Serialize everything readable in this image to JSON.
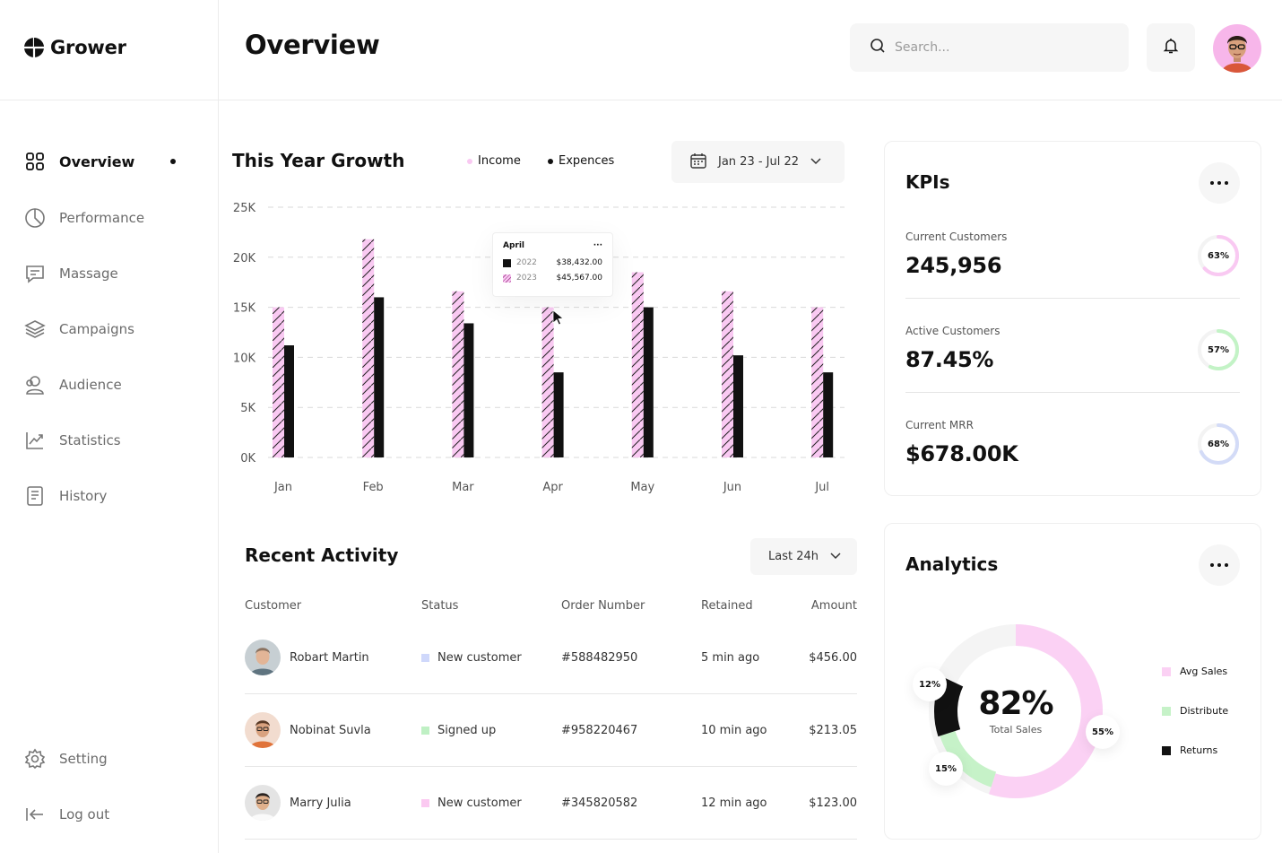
{
  "app": {
    "name": "Grower"
  },
  "sidebar": {
    "items": [
      {
        "label": "Overview",
        "icon": "grid-icon",
        "active": true
      },
      {
        "label": "Performance",
        "icon": "pie-icon"
      },
      {
        "label": "Massage",
        "icon": "message-icon"
      },
      {
        "label": "Campaigns",
        "icon": "layers-icon"
      },
      {
        "label": "Audience",
        "icon": "users-icon"
      },
      {
        "label": "Statistics",
        "icon": "trend-icon"
      },
      {
        "label": "History",
        "icon": "document-icon"
      }
    ],
    "setting_label": "Setting",
    "logout_label": "Log out"
  },
  "header": {
    "title": "Overview",
    "search_placeholder": "Search..."
  },
  "growth": {
    "title": "This Year Growth",
    "legend": [
      {
        "label": "Income",
        "color": "#f9c9f2"
      },
      {
        "label": "Expences",
        "color": "#111111"
      }
    ],
    "date_range": "Jan 23 - Jul 22",
    "tooltip": {
      "month": "April",
      "menu": "···",
      "rows": [
        {
          "year": "2022",
          "value": "$38,432.00"
        },
        {
          "year": "2023",
          "value": "$45,567.00"
        }
      ]
    }
  },
  "chart_data": {
    "type": "bar",
    "categories": [
      "Jan",
      "Feb",
      "Mar",
      "Apr",
      "May",
      "Jun",
      "Jul"
    ],
    "series": [
      {
        "name": "Income",
        "color": "#f9c9f2",
        "values": [
          15000,
          21800,
          16600,
          15000,
          18500,
          16600,
          15000
        ]
      },
      {
        "name": "Expences",
        "color": "#111111",
        "values": [
          11200,
          16000,
          13400,
          8500,
          15000,
          10200,
          8500
        ]
      }
    ],
    "y_ticks": [
      "0K",
      "5K",
      "10K",
      "15K",
      "20K",
      "25K"
    ],
    "ylim": [
      0,
      25000
    ],
    "grid": true
  },
  "activity": {
    "title": "Recent Activity",
    "filter": "Last 24h",
    "columns": [
      "Customer",
      "Status",
      "Order Number",
      "Retained",
      "Amount"
    ],
    "rows": [
      {
        "name": "Robart Martin",
        "status": "New customer",
        "status_color": "#cfd8fb",
        "order": "#588482950",
        "retained": "5 min ago",
        "amount": "$456.00"
      },
      {
        "name": "Nobinat Suvla",
        "status": "Signed up",
        "status_color": "#bff0c4",
        "order": "#958220467",
        "retained": "10 min ago",
        "amount": "$213.05"
      },
      {
        "name": "Marry Julia",
        "status": "New customer",
        "status_color": "#fbc9f1",
        "order": "#345820582",
        "retained": "12 min ago",
        "amount": "$123.00"
      }
    ]
  },
  "kpis": {
    "title": "KPIs",
    "items": [
      {
        "label": "Current Customers",
        "value": "245,956",
        "percent_label": "63%",
        "percent": 63,
        "color": "#f9c9f2"
      },
      {
        "label": "Active Customers",
        "value": "87.45%",
        "percent_label": "57%",
        "percent": 57,
        "color": "#c3f3c6"
      },
      {
        "label": "Current MRR",
        "value": "$678.00K",
        "percent_label": "68%",
        "percent": 68,
        "color": "#d3dbf7"
      }
    ]
  },
  "analytics": {
    "title": "Analytics",
    "center_value": "82%",
    "center_label": "Total Sales",
    "segments": [
      {
        "label": "Avg Sales",
        "percent": 55,
        "percent_label": "55%",
        "color": "#fbd1f4"
      },
      {
        "label": "Distribute",
        "percent": 15,
        "percent_label": "15%",
        "color": "#c6f2c8"
      },
      {
        "label": "Returns",
        "percent": 12,
        "percent_label": "12%",
        "color": "#111111"
      }
    ]
  }
}
